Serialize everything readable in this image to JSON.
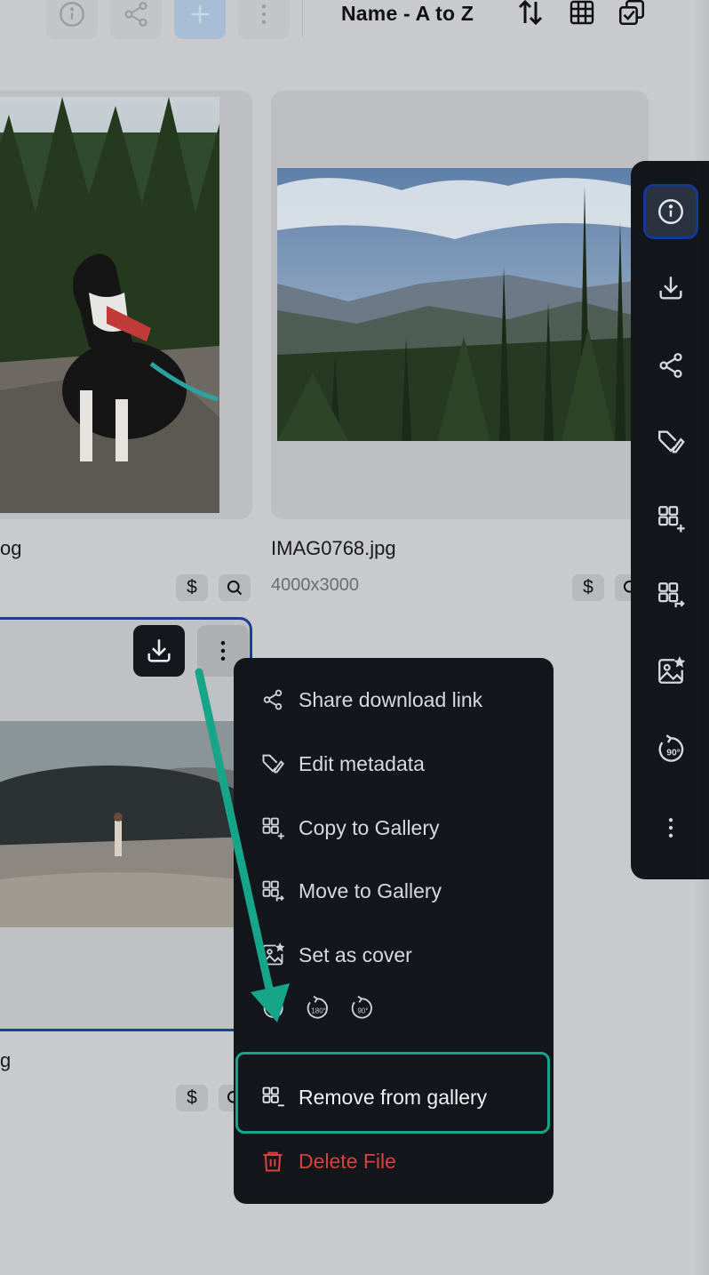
{
  "toolbar": {
    "sort_label": "Name - A to Z",
    "icons": [
      "info-icon",
      "share-icon",
      "add-icon",
      "more-vertical-icon",
      "sort-icon",
      "grid-view-icon",
      "select-icon"
    ]
  },
  "cards": [
    {
      "filename": "og",
      "dimensions": "",
      "chips": [
        "$",
        "Q"
      ]
    },
    {
      "filename": "IMAG0768.jpg",
      "dimensions": "4000x3000",
      "chips": [
        "$",
        "Q"
      ]
    },
    {
      "filename": "g",
      "dimensions": "",
      "chips": [
        "$",
        "Q"
      ]
    }
  ],
  "chip_labels": {
    "price": "$"
  },
  "sidepanel": {
    "icons": [
      "info-icon",
      "download-icon",
      "share-icon",
      "edit-metadata-icon",
      "copy-to-gallery-icon",
      "move-to-gallery-icon",
      "set-cover-icon",
      "rotate-90-icon",
      "more-vertical-icon"
    ]
  },
  "menu": {
    "share": "Share download link",
    "edit_metadata": "Edit metadata",
    "copy_to_gallery": "Copy to Gallery",
    "move_to_gallery": "Move to Gallery",
    "set_cover": "Set as cover",
    "rotate_180": "180°",
    "rotate_90": "90°",
    "remove_from_gallery": "Remove from gallery",
    "delete_file": "Delete File"
  },
  "colors": {
    "menu_bg": "#13161b",
    "highlight": "#17a58a",
    "danger": "#d8403d",
    "selected_border": "#1d3f8f"
  }
}
